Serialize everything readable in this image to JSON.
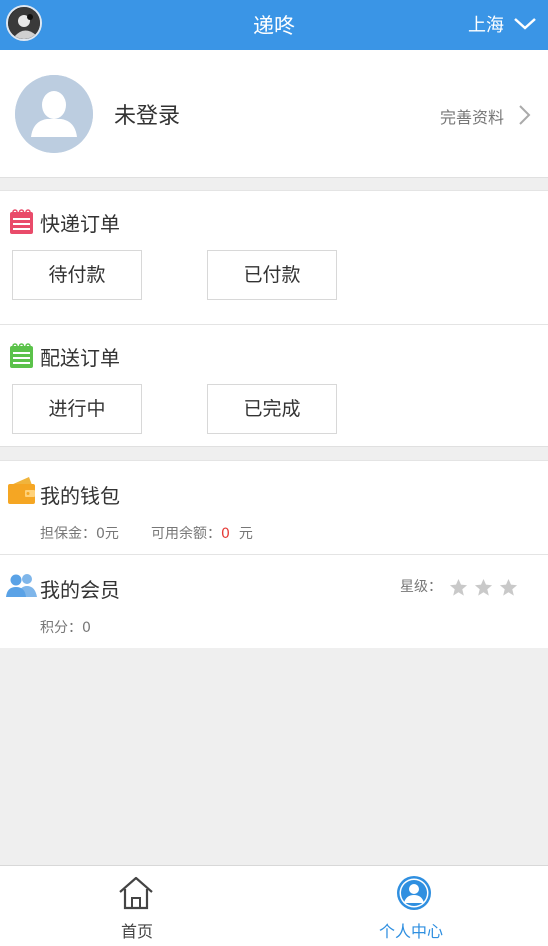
{
  "header": {
    "title": "递咚",
    "city": "上海",
    "accent_color": "#3a95e6"
  },
  "profile": {
    "login_status": "未登录",
    "complete_profile": "完善资料"
  },
  "express_orders": {
    "title": "快递订单",
    "icon": "notepad-icon",
    "icon_color": "#e94b6a",
    "buttons": [
      "待付款",
      "已付款"
    ]
  },
  "delivery_orders": {
    "title": "配送订单",
    "icon": "notepad-icon",
    "icon_color": "#5bc24a",
    "buttons": [
      "进行中",
      "已完成"
    ]
  },
  "wallet": {
    "title": "我的钱包",
    "icon": "wallet-icon",
    "deposit_label": "担保金：",
    "deposit_value": "0元",
    "balance_label": "可用余额：",
    "balance_value": "0",
    "balance_unit": "元"
  },
  "membership": {
    "title": "我的会员",
    "icon": "users-icon",
    "points_label": "积分：",
    "points_value": "0",
    "star_label": "星级：",
    "stars": 0,
    "star_max": 3
  },
  "tabbar": {
    "home": "首页",
    "profile": "个人中心",
    "active_color": "#2f8fe0",
    "inactive_color": "#444444"
  }
}
